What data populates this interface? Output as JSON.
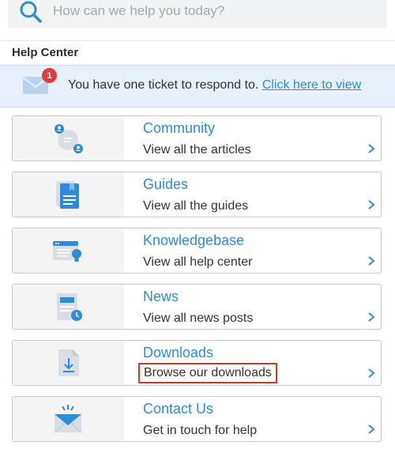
{
  "search": {
    "placeholder": "How can we help you today?"
  },
  "header": {
    "title": "Help Center"
  },
  "notice": {
    "badge_count": "1",
    "text": "You have one ticket to respond to.",
    "link_text": "Click here to view"
  },
  "cards": [
    {
      "title": "Community",
      "description": "View all the articles",
      "icon": "community-icon"
    },
    {
      "title": "Guides",
      "description": "View all the guides",
      "icon": "guide-document-icon"
    },
    {
      "title": "Knowledgebase",
      "description": "View all help center",
      "icon": "knowledgebase-lightbulb-icon"
    },
    {
      "title": "News",
      "description": "View all news posts",
      "icon": "news-clock-icon"
    },
    {
      "title": "Downloads",
      "description": "Browse our downloads",
      "icon": "download-file-icon"
    },
    {
      "title": "Contact Us",
      "description": "Get in touch for help",
      "icon": "envelope-icon"
    }
  ],
  "colors": {
    "accent": "#2e8bd8",
    "badge": "#e23b3b",
    "highlight_border": "#d9352b",
    "notice_bg": "#e7f1fb"
  }
}
